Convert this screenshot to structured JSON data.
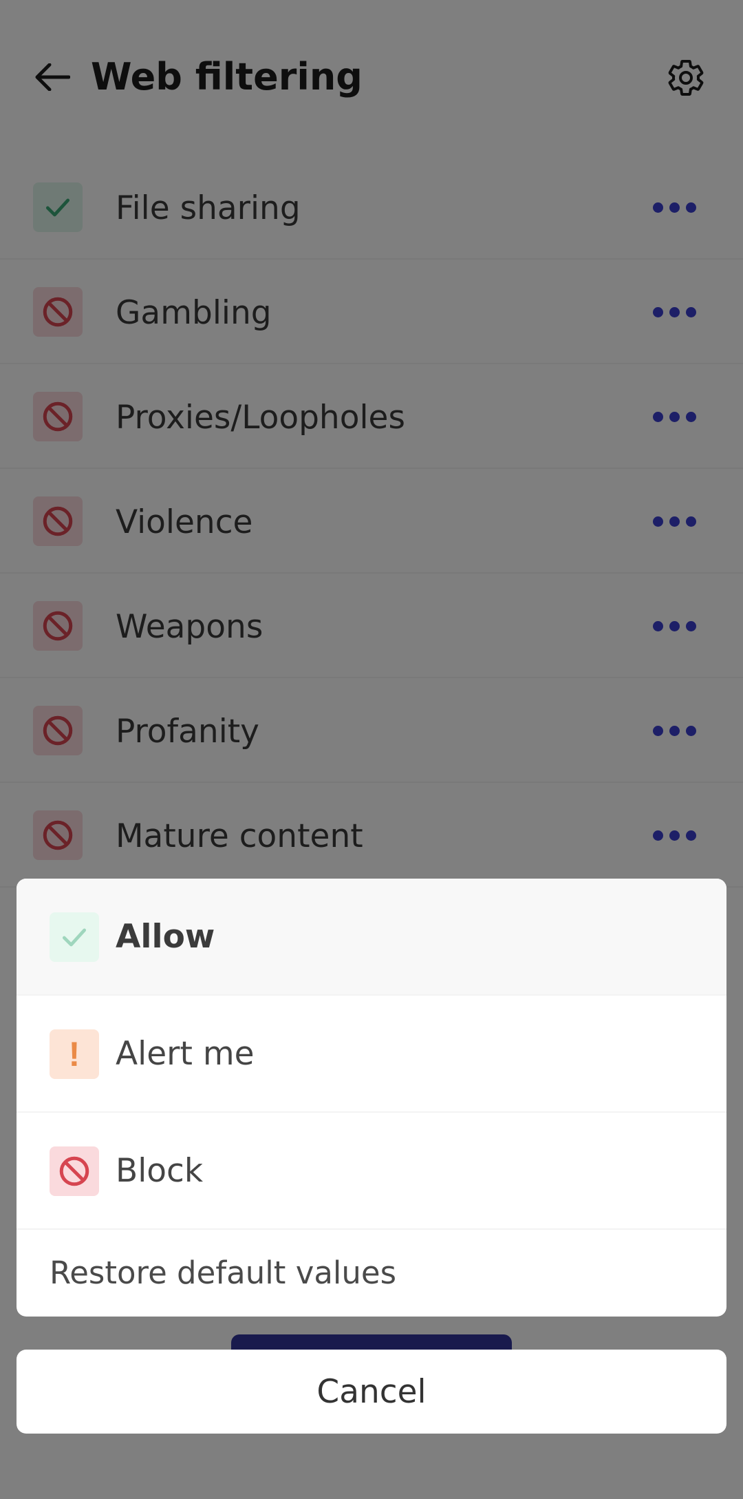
{
  "header": {
    "back_icon": "arrow-left-icon",
    "title": "Web filtering",
    "settings_icon": "gear-icon"
  },
  "categories": [
    {
      "label": "File sharing",
      "status": "allow",
      "status_icon": "check-icon",
      "more_icon": "more-dots-icon"
    },
    {
      "label": "Gambling",
      "status": "block",
      "status_icon": "block-icon",
      "more_icon": "more-dots-icon"
    },
    {
      "label": "Proxies/Loopholes",
      "status": "block",
      "status_icon": "block-icon",
      "more_icon": "more-dots-icon"
    },
    {
      "label": "Violence",
      "status": "block",
      "status_icon": "block-icon",
      "more_icon": "more-dots-icon"
    },
    {
      "label": "Weapons",
      "status": "block",
      "status_icon": "block-icon",
      "more_icon": "more-dots-icon"
    },
    {
      "label": "Profanity",
      "status": "block",
      "status_icon": "block-icon",
      "more_icon": "more-dots-icon"
    },
    {
      "label": "Mature content",
      "status": "block",
      "status_icon": "block-icon",
      "more_icon": "more-dots-icon"
    }
  ],
  "sheet": {
    "options": [
      {
        "label": "Allow",
        "icon": "check-icon",
        "selected": true
      },
      {
        "label": "Alert me",
        "icon": "exclamation-icon",
        "glyph": "!",
        "selected": false
      },
      {
        "label": "Block",
        "icon": "block-icon",
        "selected": false
      }
    ],
    "restore_label": "Restore default values",
    "cancel_label": "Cancel"
  },
  "colors": {
    "accent": "#3a3fcf",
    "primary_button": "#33349a",
    "allow_green": "#3aa876",
    "alert_orange": "#ea8a47",
    "block_red": "#d64550",
    "scrim": "rgba(0,0,0,0.5)"
  }
}
